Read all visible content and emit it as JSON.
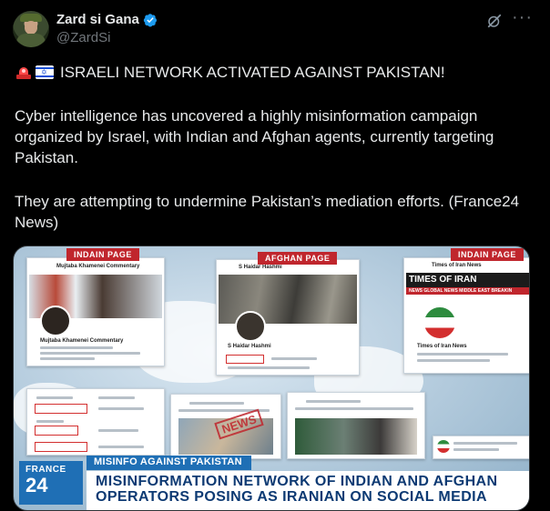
{
  "author": {
    "display_name": "Zard si Gana",
    "handle": "@ZardSi"
  },
  "icons": {
    "verified": "verified-badge-icon",
    "grok": "grok-icon",
    "more": "more-options-icon",
    "siren": "police-light-emoji",
    "israel_flag": "israel-flag-emoji"
  },
  "tweet": {
    "headline": "ISRAELI NETWORK ACTIVATED AGAINST PAKISTAN!",
    "paragraph_1": "Cyber intelligence has uncovered a highly misinformation campaign organized by Israel, with Indian and Afghan agents, currently targeting Pakistan.",
    "paragraph_2": "They are attempting to undermine Pakistan’s mediation efforts. (France24 News)"
  },
  "media": {
    "tags": {
      "left": "INDAIN PAGE",
      "center": "AFGHAN PAGE",
      "right": "INDAIN PAGE"
    },
    "right_card_banner": "TIMES OF IRAN",
    "right_card_nav": "NEWS  GLOBAL NEWS  MIDDLE EAST  BREAKIN",
    "stamp": "NEWS",
    "channel_logo_top": "FRANCE",
    "channel_logo_number": "24",
    "strap_top": "MISINFO AGAINST PAKISTAN",
    "strap_main": "MISINFORMATION NETWORK OF INDIAN AND AFGHAN OPERATORS POSING AS IRANIAN ON SOCIAL MEDIA"
  },
  "colors": {
    "background": "#000000",
    "text": "#e7e9ea",
    "muted": "#71767b",
    "verified_blue": "#1d9bf0",
    "france24_blue": "#1f6fb5",
    "tag_red": "#c0262d"
  }
}
